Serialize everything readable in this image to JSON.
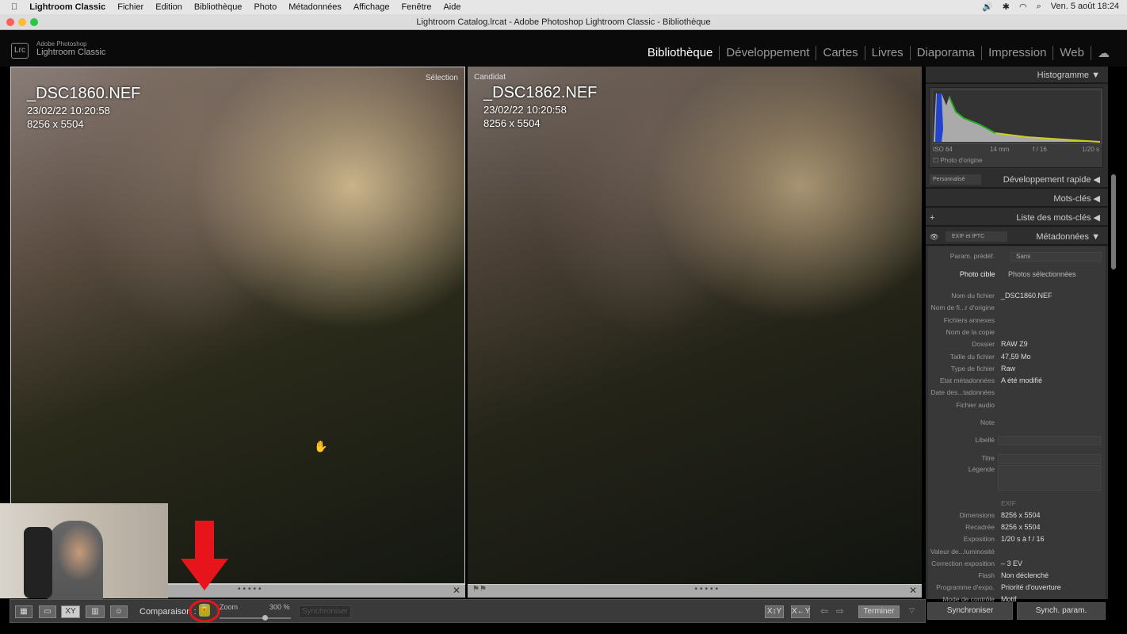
{
  "menubar": {
    "app": "Lightroom Classic",
    "items": [
      "Fichier",
      "Edition",
      "Bibliothèque",
      "Photo",
      "Métadonnées",
      "Affichage",
      "Fenêtre",
      "Aide"
    ],
    "datetime": "Ven. 5 août  18:24"
  },
  "window": {
    "title": "Lightroom Catalog.lrcat - Adobe Photoshop Lightroom Classic - Bibliothèque"
  },
  "logo": {
    "badge": "Lrc",
    "line1": "Adobe Photoshop",
    "line2": "Lightroom Classic"
  },
  "modules": [
    "Bibliothèque",
    "Développement",
    "Cartes",
    "Livres",
    "Diaporama",
    "Impression",
    "Web"
  ],
  "left_photo": {
    "label": "Sélection",
    "filename": "_DSC1860.NEF",
    "date": "23/02/22 10:20:58",
    "size": "8256 x 5504"
  },
  "right_photo": {
    "label": "Candidat",
    "filename": "_DSC1862.NEF",
    "date": "23/02/22 10:20:58",
    "size": "8256 x 5504"
  },
  "toolbar": {
    "comparison": "Comparaison :",
    "zoom_label": "Zoom",
    "zoom_value": "300 %",
    "sync": "Synchroniser",
    "finish": "Terminer",
    "lock_locked": true
  },
  "panel": {
    "histogram": {
      "title": "Histogramme",
      "iso": "ISO 64",
      "focal": "14 mm",
      "aperture": "f / 16",
      "shutter": "1/20 s",
      "original": "Photo d'origine"
    },
    "quick_dev": {
      "preset": "Personnalisé",
      "title": "Développement rapide"
    },
    "keywords": "Mots-clés",
    "keyword_list": "Liste des mots-clés",
    "metadata": {
      "preset_set": "EXIF et IPTC",
      "title": "Métadonnées",
      "param_label": "Param. prédéf.",
      "param_value": "Sans",
      "tab_target": "Photo cible",
      "tab_selected": "Photos sélectionnées",
      "rows": [
        {
          "k": "Nom du fichier",
          "v": "_DSC1860.NEF"
        },
        {
          "k": "Nom de fi...r d'origine",
          "v": ""
        },
        {
          "k": "Fichiers annexes",
          "v": ""
        },
        {
          "k": "Nom de la copie",
          "v": ""
        },
        {
          "k": "Dossier",
          "v": "RAW Z9"
        },
        {
          "k": "Taille du fichier",
          "v": "47,59 Mo"
        },
        {
          "k": "Type de fichier",
          "v": "Raw"
        },
        {
          "k": "Etat métadonnées",
          "v": "A été modifié"
        },
        {
          "k": "Date des...tadonnées",
          "v": ""
        },
        {
          "k": "Fichier audio",
          "v": ""
        }
      ],
      "note": "Note",
      "label": "Libellé",
      "title_field": "Titre",
      "caption": "Légende",
      "exif": "EXIF",
      "exif_rows": [
        {
          "k": "Dimensions",
          "v": "8256 x 5504"
        },
        {
          "k": "Recadrée",
          "v": "8256 x 5504"
        },
        {
          "k": "Exposition",
          "v": "1/20 s à f / 16"
        },
        {
          "k": "Valeur de...luminosité",
          "v": ""
        },
        {
          "k": "Correction exposition",
          "v": "– 3 EV"
        },
        {
          "k": "Flash",
          "v": "Non déclenché"
        },
        {
          "k": "Programme d'expo.",
          "v": "Priorité d'ouverture"
        },
        {
          "k": "Mode de contrôle",
          "v": "Motif"
        }
      ]
    },
    "sync": "Synchroniser",
    "sync_settings": "Synch. param."
  },
  "colors": {
    "annotation": "#e8141b",
    "lock": "#b5a52a"
  }
}
